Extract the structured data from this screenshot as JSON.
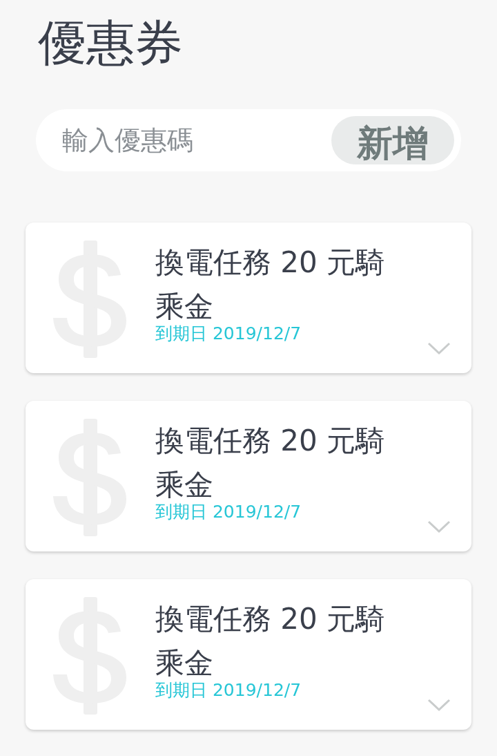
{
  "title": "優惠券",
  "code_field": {
    "placeholder": "輸入優惠碼"
  },
  "add_button": "新增",
  "coupons": [
    {
      "name": "換電任務 20 元騎乘金",
      "expiry": "到期日 2019/12/7",
      "expanded": false
    },
    {
      "name": "換電任務 20 元騎乘金",
      "expiry": "到期日 2019/12/7",
      "expanded": false
    },
    {
      "name": "換電任務 20 元騎乘金",
      "expiry": "到期日 2019/12/7",
      "expanded": false
    }
  ]
}
